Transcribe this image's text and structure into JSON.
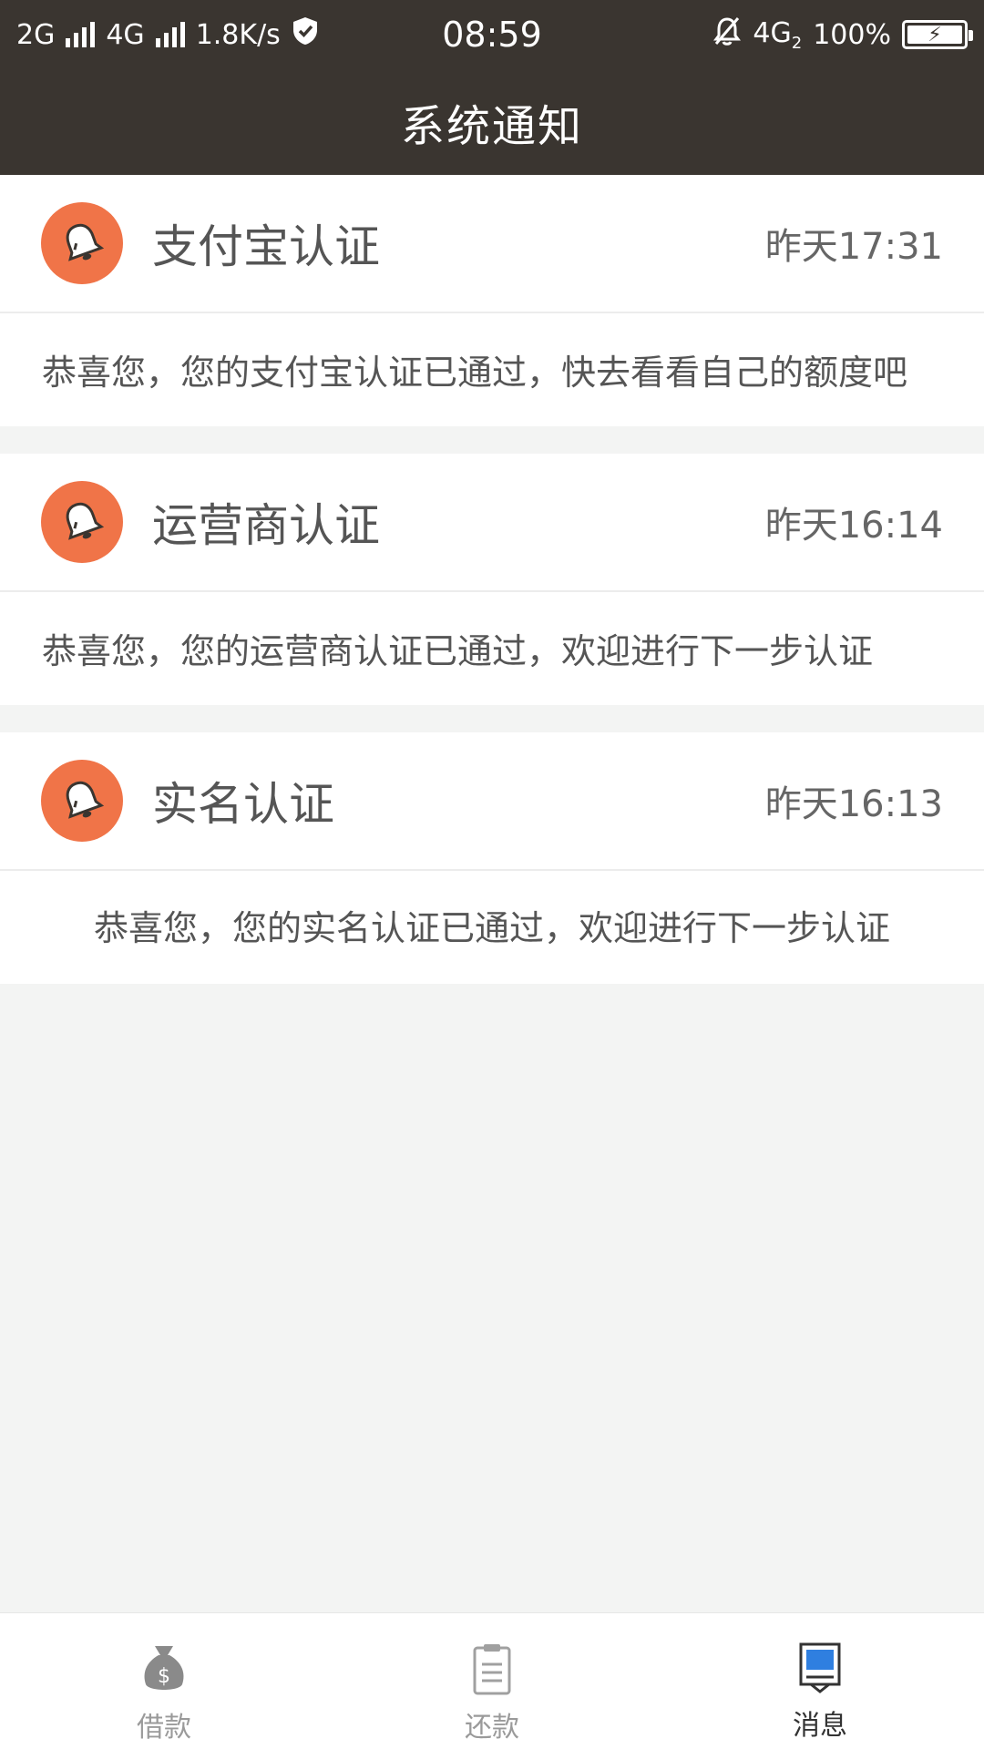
{
  "statusbar": {
    "net1": "2G",
    "net2": "4G",
    "speed": "1.8K/s",
    "time": "08:59",
    "net3": "4G",
    "net3_sub": "2",
    "battery": "100%",
    "battery_level": 100
  },
  "header": {
    "title": "系统通知"
  },
  "notifications": [
    {
      "title": "支付宝认证",
      "time": "昨天17:31",
      "body": "恭喜您，您的支付宝认证已通过，快去看看自己的额度吧"
    },
    {
      "title": "运营商认证",
      "time": "昨天16:14",
      "body": "恭喜您，您的运营商认证已通过，欢迎进行下一步认证"
    },
    {
      "title": "实名认证",
      "time": "昨天16:13",
      "body": "恭喜您，您的实名认证已通过，欢迎进行下一步认证"
    }
  ],
  "tabs": [
    {
      "label": "借款",
      "icon": "money-bag-icon"
    },
    {
      "label": "还款",
      "icon": "clipboard-icon"
    },
    {
      "label": "消息",
      "icon": "message-icon",
      "active": true
    }
  ],
  "colors": {
    "header_bg": "#3a3530",
    "bell_bg": "#f07448",
    "page_bg": "#f3f4f3",
    "tab_active_icon": "#2f7fe0"
  }
}
